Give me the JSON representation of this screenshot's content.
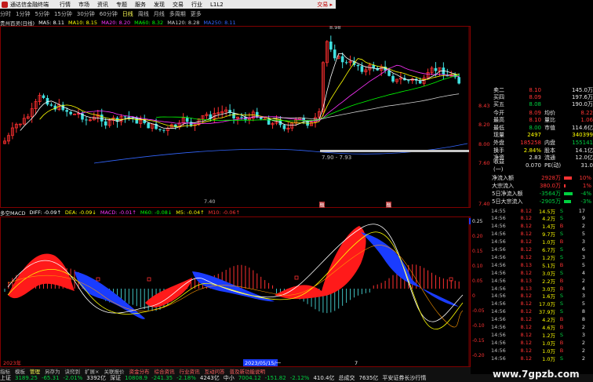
{
  "titlebar": {
    "app_title": "通达信金融终端",
    "menu": [
      "行情",
      "市场",
      "资讯",
      "专题",
      "服务",
      "发现",
      "交易",
      "行业",
      "L1L2"
    ],
    "trade_label": "交易 ▸"
  },
  "toolbar": {
    "periods": [
      "分时",
      "1分钟",
      "5分钟",
      "15分钟",
      "30分钟",
      "60分钟",
      "日线",
      "周线",
      "月线",
      "多周期",
      "更多"
    ],
    "active_period": "日线"
  },
  "ma_legend": {
    "stock": "贵州百灵(日线)",
    "items": [
      {
        "label": "MA5: 8.11",
        "color": "#ffffff"
      },
      {
        "label": "MA10: 8.15",
        "color": "#ffff00"
      },
      {
        "label": "MA20: 8.20",
        "color": "#ff33ff"
      },
      {
        "label": "MA60: 8.32",
        "color": "#00ff00"
      },
      {
        "label": "MA120: 8.28",
        "color": "#d0d0d0"
      },
      {
        "label": "MA250: 8.11",
        "color": "#3366ff"
      }
    ]
  },
  "kline": {
    "high_label": "8.98",
    "low_label": "7.40",
    "range_label": "7.90 - 7.93",
    "price_axis": [
      "8.43",
      "8.20",
      "8.00",
      "7.60",
      "7.40"
    ],
    "markers": [
      "融",
      "融"
    ]
  },
  "macd_legend": {
    "title": "多空MACD",
    "items": [
      {
        "label": "DIFF: -0.09↑",
        "color": "#ffffff"
      },
      {
        "label": "DEA: -0.09↓",
        "color": "#ffff00"
      },
      {
        "label": "MACD: -0.01↑",
        "color": "#ff33ff"
      },
      {
        "label": "M60: -0.08↓",
        "color": "#00ff00"
      },
      {
        "label": "M5: -0.04↑",
        "color": "#ffff00"
      },
      {
        "label": "M10: -0.06↑",
        "color": "#ff3333"
      }
    ]
  },
  "macd_axis": [
    "0.25",
    "0.20",
    "0.15",
    "0.10",
    "0.05",
    "0",
    "-0.05",
    "-0.10",
    "-0.15",
    "-0.20"
  ],
  "time_axis": [
    "2023年",
    "2023/05/15/一",
    "7"
  ],
  "tabs": {
    "items": [
      "指标",
      "模板",
      "管理",
      "另存为",
      "诀窍到",
      "扩展×",
      "关联报价",
      "资金分布",
      "综合资讯",
      "行业资讯",
      "互动问答",
      "普及新功能说明"
    ],
    "selected": "管理"
  },
  "quote": {
    "top": [
      {
        "l": "卖二",
        "v1": "8.10",
        "l2": "",
        "v2": "145.0万",
        "c1": "red",
        "c2": "white"
      },
      {
        "l": "买四",
        "v1": "8.09",
        "l2": "",
        "v2": "197.6万",
        "c1": "red",
        "c2": "white"
      },
      {
        "l": "买五",
        "v1": "8.08",
        "l2": "",
        "v2": "190.0万",
        "c1": "green",
        "c2": "white"
      }
    ],
    "rows": [
      {
        "l": "今开",
        "v1": "8.09",
        "l2": "均价",
        "v2": "8.22",
        "c1": "red",
        "c2": "red"
      },
      {
        "l": "最高",
        "v1": "8.10",
        "l2": "量比",
        "v2": "1.06",
        "c1": "red",
        "c2": "red"
      },
      {
        "l": "最低",
        "v1": "8.00",
        "l2": "市值",
        "v2": "114.6亿",
        "c1": "green",
        "c2": "white"
      },
      {
        "l": "现量",
        "v1": "2497",
        "l2": "",
        "v2": "340399",
        "c1": "yellow",
        "c2": "yellow"
      },
      {
        "l": "外盘",
        "v1": "185258",
        "l2": "内盘",
        "v2": "155141",
        "c1": "red",
        "c2": "green"
      },
      {
        "l": "换手",
        "v1": "2.84%",
        "l2": "股本",
        "v2": "14.1亿",
        "c1": "yellow",
        "c2": "white"
      },
      {
        "l": "净资",
        "v1": "2.83",
        "l2": "流通",
        "v2": "12.0亿",
        "c1": "white",
        "c2": "white"
      },
      {
        "l": "收益(一)",
        "v1": "0.070",
        "l2": "PE(动)",
        "v2": "31.0",
        "c1": "white",
        "c2": "white"
      }
    ]
  },
  "fund_flow": [
    {
      "label": "净流入额",
      "value": "2928万",
      "pct": "10%",
      "color": "#ff3333",
      "fill": 0.5
    },
    {
      "label": "大宗流入",
      "value": "380.0万",
      "pct": "1%",
      "color": "#ff3333",
      "fill": 0.1
    },
    {
      "label": "5日净流入额",
      "value": "-3564万",
      "pct": "-4%",
      "color": "#00d040",
      "fill": 0.55
    },
    {
      "label": "5日大宗流入",
      "value": "-2905万",
      "pct": "-3%",
      "color": "#00d040",
      "fill": 0.45
    }
  ],
  "ticks": [
    {
      "t": "14:55",
      "p": "8.12",
      "v": "14.5万",
      "d": "S",
      "n": "17",
      "pc": "red",
      "dc": "green"
    },
    {
      "t": "14:56",
      "p": "8.12",
      "v": "4.2万",
      "d": "S",
      "n": "9",
      "pc": "red",
      "dc": "green"
    },
    {
      "t": "14:56",
      "p": "8.12",
      "v": "1.4万",
      "d": "B",
      "n": "2",
      "pc": "red",
      "dc": "red"
    },
    {
      "t": "14:56",
      "p": "8.12",
      "v": "9.7万",
      "d": "S",
      "n": "5",
      "pc": "red",
      "dc": "green"
    },
    {
      "t": "14:56",
      "p": "8.12",
      "v": "1.0万",
      "d": "B",
      "n": "3",
      "pc": "red",
      "dc": "red"
    },
    {
      "t": "14:56",
      "p": "8.12",
      "v": "6.7万",
      "d": "S",
      "n": "6",
      "pc": "red",
      "dc": "green"
    },
    {
      "t": "14:56",
      "p": "8.12",
      "v": "1.2万",
      "d": "S",
      "n": "3",
      "pc": "red",
      "dc": "green"
    },
    {
      "t": "14:56",
      "p": "8.13",
      "v": "5.1万",
      "d": "B",
      "n": "5",
      "pc": "red",
      "dc": "red"
    },
    {
      "t": "14:56",
      "p": "8.12",
      "v": "3.0万",
      "d": "S",
      "n": "4",
      "pc": "red",
      "dc": "green"
    },
    {
      "t": "14:56",
      "p": "8.13",
      "v": "2.2万",
      "d": "B",
      "n": "2",
      "pc": "red",
      "dc": "red"
    },
    {
      "t": "14:56",
      "p": "8.13",
      "v": "3.0万",
      "d": "B",
      "n": "4",
      "pc": "red",
      "dc": "red"
    },
    {
      "t": "14:56",
      "p": "8.12",
      "v": "1.6万",
      "d": "S",
      "n": "3",
      "pc": "red",
      "dc": "green"
    },
    {
      "t": "14:56",
      "p": "8.12",
      "v": "17.0万",
      "d": "S",
      "n": "5",
      "pc": "red",
      "dc": "green"
    },
    {
      "t": "14:56",
      "p": "8.12",
      "v": "37.9万",
      "d": "S",
      "n": "8",
      "pc": "red",
      "dc": "green"
    },
    {
      "t": "14:56",
      "p": "8.12",
      "v": "4.2万",
      "d": "B",
      "n": "8",
      "pc": "red",
      "dc": "red"
    },
    {
      "t": "14:56",
      "p": "8.12",
      "v": "4.6万",
      "d": "B",
      "n": "2",
      "pc": "red",
      "dc": "red"
    },
    {
      "t": "14:56",
      "p": "8.12",
      "v": "1.2万",
      "d": "S",
      "n": "3",
      "pc": "red",
      "dc": "green"
    },
    {
      "t": "14:56",
      "p": "8.12",
      "v": "1.0万",
      "d": "B",
      "n": "2",
      "pc": "red",
      "dc": "red"
    },
    {
      "t": "14:56",
      "p": "8.12",
      "v": "1.0万",
      "d": "B",
      "n": "2",
      "pc": "red",
      "dc": "red"
    },
    {
      "t": "14:56",
      "p": "8.12",
      "v": "1.0万",
      "d": "S",
      "n": "2",
      "pc": "red",
      "dc": "green"
    }
  ],
  "statusbar": [
    {
      "text": "上证",
      "c": "white"
    },
    {
      "text": "3189.25",
      "c": "green"
    },
    {
      "text": "-65.31",
      "c": "green"
    },
    {
      "text": "-2.01%",
      "c": "green"
    },
    {
      "text": "3392亿",
      "c": "white"
    },
    {
      "text": "深证",
      "c": "white"
    },
    {
      "text": "10808.9",
      "c": "green"
    },
    {
      "text": "-241.35",
      "c": "green"
    },
    {
      "text": "-2.18%",
      "c": "green"
    },
    {
      "text": "4243亿",
      "c": "white"
    },
    {
      "text": "中小",
      "c": "white"
    },
    {
      "text": "7004.12",
      "c": "green"
    },
    {
      "text": "-151.82",
      "c": "green"
    },
    {
      "text": "-2.12%",
      "c": "green"
    },
    {
      "text": "410.4亿",
      "c": "white"
    },
    {
      "text": "总成交",
      "c": "white"
    },
    {
      "text": "7635亿",
      "c": "white"
    },
    {
      "text": "平安证券长沙行情",
      "c": "white"
    }
  ],
  "watermark": "www.7gpzb.com"
}
